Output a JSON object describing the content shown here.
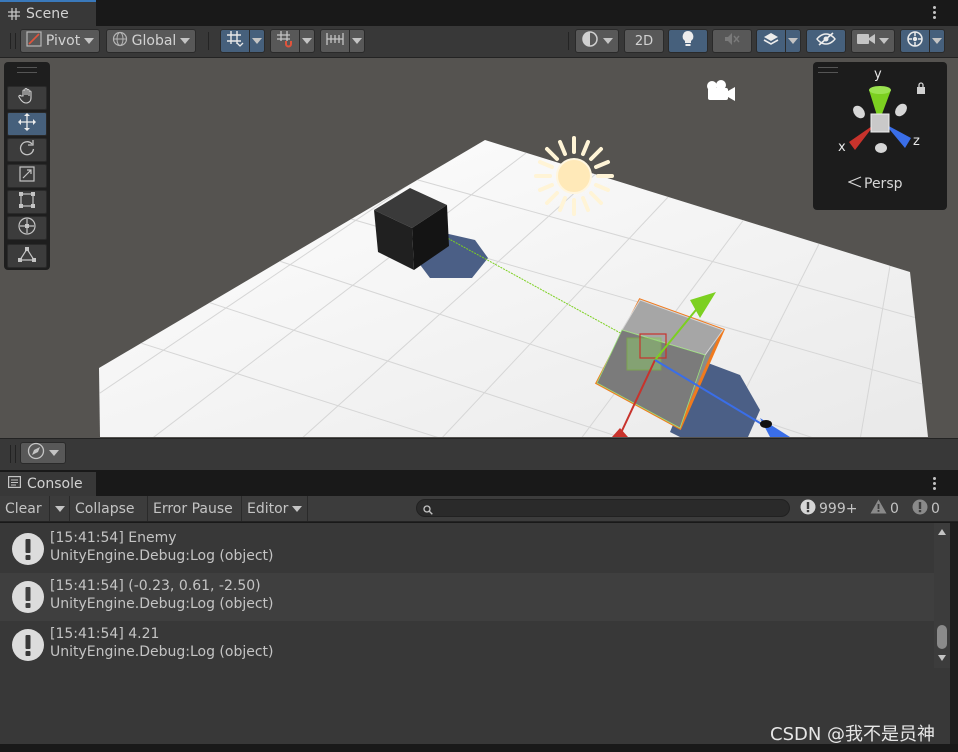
{
  "scene_tab": {
    "title": "Scene"
  },
  "scene_toolbar": {
    "pivot_label": "Pivot",
    "global_label": "Global",
    "mode_2d_label": "2D"
  },
  "gizmo": {
    "axis_y": "y",
    "axis_x": "x",
    "axis_z": "z",
    "projection_label": "Persp"
  },
  "console_tab": {
    "title": "Console"
  },
  "console_toolbar": {
    "clear_label": "Clear",
    "collapse_label": "Collapse",
    "error_pause_label": "Error Pause",
    "editor_label": "Editor",
    "search_value": "",
    "log_count": "999+",
    "warning_count": "0",
    "error_count": "0"
  },
  "console_entries": [
    {
      "message": "[15:41:54] Enemy",
      "source": "UnityEngine.Debug:Log (object)"
    },
    {
      "message": "[15:41:54] (-0.23, 0.61, -2.50)",
      "source": "UnityEngine.Debug:Log (object)"
    },
    {
      "message": "[15:41:54] 4.21",
      "source": "UnityEngine.Debug:Log (object)"
    }
  ],
  "watermark": "CSDN @我不是员神",
  "colors": {
    "accent": "#46607c",
    "selection_outline": "#f07a1e",
    "axis_x": "#c8332c",
    "axis_y": "#7cd020",
    "axis_z": "#3a6ee8",
    "ground": "#f2f2f2",
    "skybox": "#555350"
  }
}
